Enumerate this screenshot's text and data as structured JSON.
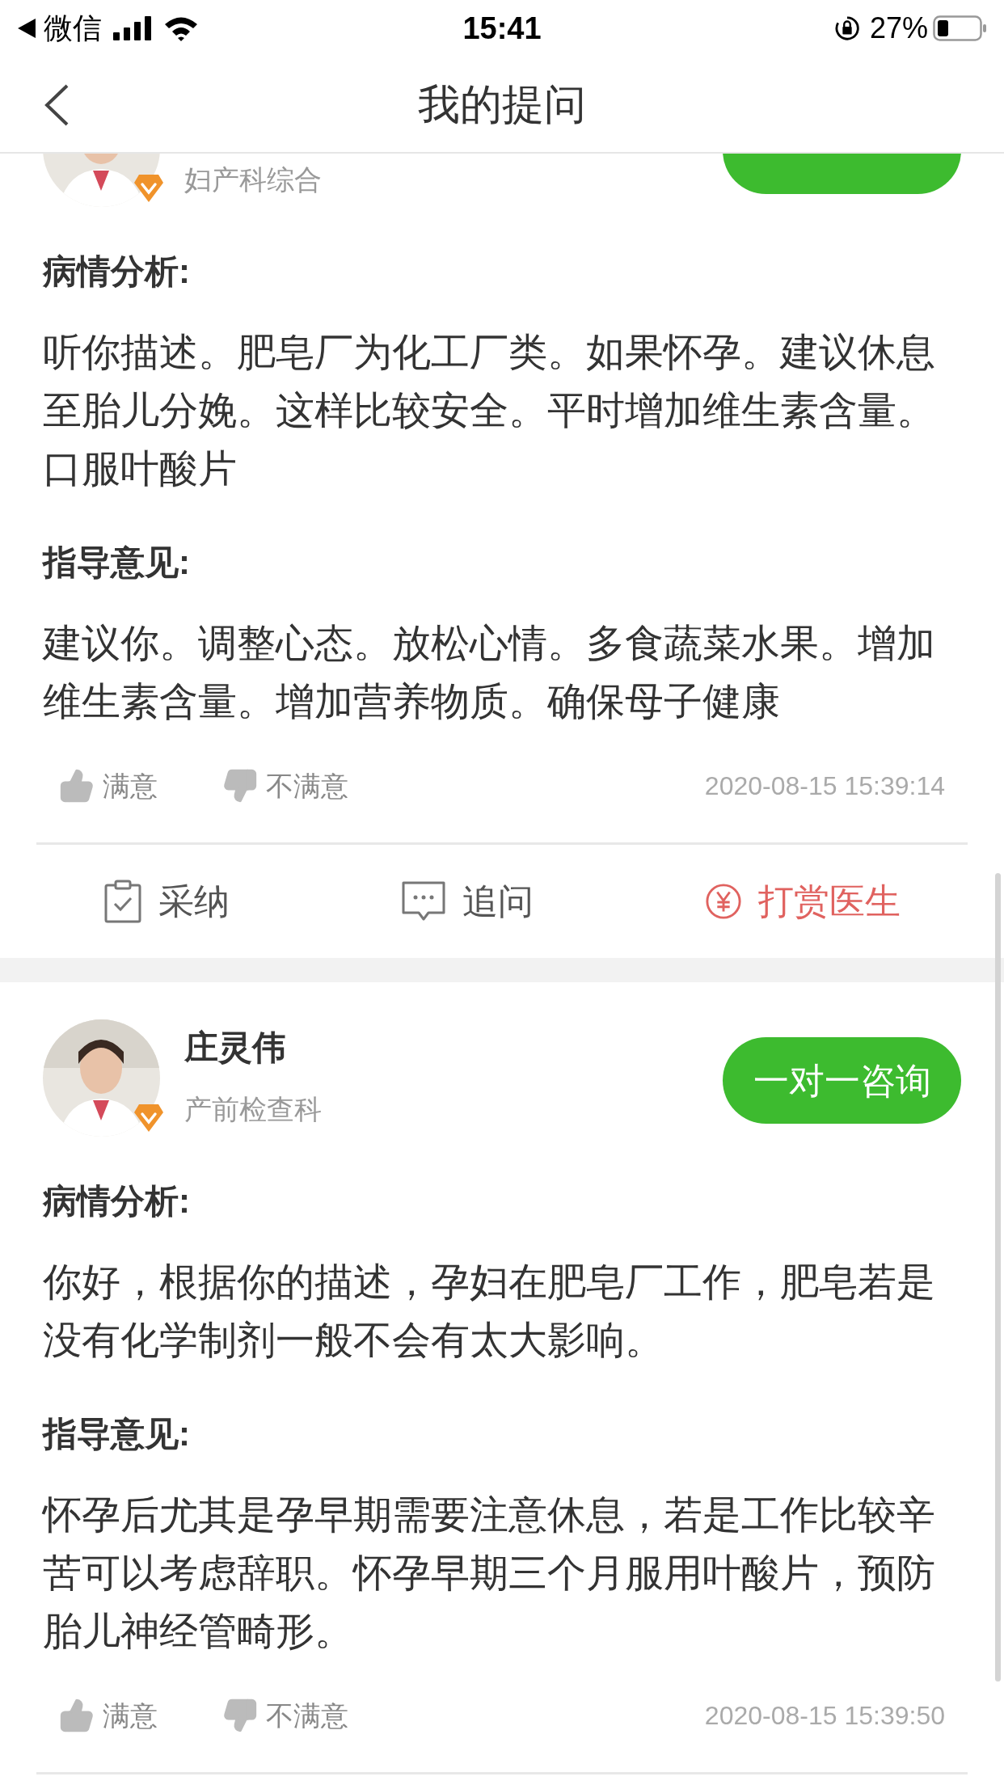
{
  "status_bar": {
    "back_app": "微信",
    "time": "15:41",
    "battery": "27%"
  },
  "header": {
    "title": "我的提问"
  },
  "answers": [
    {
      "department": "妇产科综合",
      "sections": [
        {
          "heading": "病情分析:",
          "text": "听你描述。肥皂厂为化工厂类。如果怀孕。建议休息至胎儿分娩。这样比较安全。平时增加维生素含量。口服叶酸片"
        },
        {
          "heading": "指导意见:",
          "text": "建议你。调整心态。放松心情。多食蔬菜水果。增加维生素含量。增加营养物质。确保母子健康"
        }
      ],
      "ratings": [
        {
          "kind": "up",
          "label": "满意"
        },
        {
          "kind": "down",
          "label": "不满意"
        }
      ],
      "time": "2020-08-15 15:39:14",
      "actions": [
        {
          "kind": "adopt",
          "label": "采纳"
        },
        {
          "kind": "ask",
          "label": "追问"
        },
        {
          "kind": "reward",
          "label": "打赏医生"
        }
      ]
    },
    {
      "name": "庄灵伟",
      "department": "产前检查科",
      "consult_button": "一对一咨询",
      "sections": [
        {
          "heading": "病情分析:",
          "text": "你好，根据你的描述，孕妇在肥皂厂工作，肥皂若是没有化学制剂一般不会有太大影响。"
        },
        {
          "heading": "指导意见:",
          "text": "怀孕后尤其是孕早期需要注意休息，若是工作比较辛苦可以考虑辞职。怀孕早期三个月服用叶酸片，预防胎儿神经管畸形。"
        }
      ],
      "ratings": [
        {
          "kind": "up",
          "label": "满意"
        },
        {
          "kind": "down",
          "label": "不满意"
        }
      ],
      "time": "2020-08-15 15:39:50"
    }
  ]
}
